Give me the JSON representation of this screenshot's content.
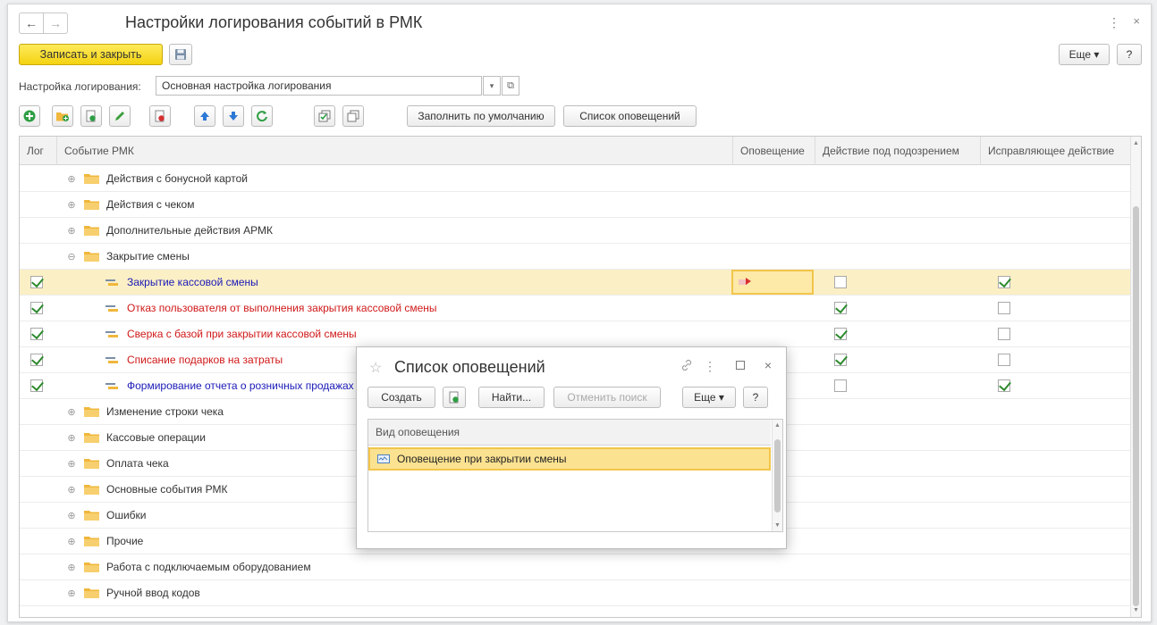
{
  "window": {
    "title": "Настройки логирования событий в РМК",
    "menu_icon": "⋮",
    "close_icon": "×",
    "back_icon": "←",
    "forward_icon": "→"
  },
  "command_bar": {
    "write_close_label": "Записать и закрыть",
    "more_label": "Еще ▾",
    "help_label": "?"
  },
  "setting": {
    "label": "Настройка логирования:",
    "value": "Основная настройка логирования",
    "dropdown_icon": "▾",
    "open_icon": "⧉"
  },
  "toolbar": {
    "fill_default_label": "Заполнить по умолчанию",
    "notification_list_label": "Список оповещений",
    "icons": [
      "add-icon",
      "add-folder-icon",
      "copy-icon",
      "edit-icon",
      "delete-icon",
      "move-up-icon",
      "move-down-icon",
      "refresh-icon",
      "select-all-icon",
      "deselect-all-icon"
    ]
  },
  "table": {
    "columns": {
      "log": "Лог",
      "event": "Событие РМК",
      "notification": "Оповещение",
      "suspicion_action": "Действие под подозрением",
      "corrective_action": "Исправляющее действие"
    },
    "groups_top": [
      {
        "name": "Действия с бонусной картой",
        "toggle": "⊕"
      },
      {
        "name": "Действия с чеком",
        "toggle": "⊕"
      },
      {
        "name": "Дополнительные действия АРМК",
        "toggle": "⊕"
      },
      {
        "name": "Закрытие смены",
        "toggle": "⊖"
      }
    ],
    "items": [
      {
        "name": "Закрытие кассовой смены",
        "color": "#1a1ab8",
        "log": true,
        "suspicion": false,
        "corrective": true
      },
      {
        "name": "Отказ пользователя от выполнения закрытия кассовой смены",
        "color": "#d01818",
        "log": true,
        "suspicion": true,
        "corrective": false
      },
      {
        "name": "Сверка с базой при закрытии кассовой смены",
        "color": "#d01818",
        "log": true,
        "suspicion": true,
        "corrective": false
      },
      {
        "name": "Списание подарков на затраты",
        "color": "#d01818",
        "log": true,
        "suspicion": true,
        "corrective": false
      },
      {
        "name": "Формирование отчета о розничных продажах",
        "color": "#1a1ab8",
        "log": true,
        "suspicion": false,
        "corrective": true
      }
    ],
    "groups_bottom": [
      {
        "name": "Изменение строки чека",
        "toggle": "⊕"
      },
      {
        "name": "Кассовые операции",
        "toggle": "⊕"
      },
      {
        "name": "Оплата чека",
        "toggle": "⊕"
      },
      {
        "name": "Основные события РМК",
        "toggle": "⊕"
      },
      {
        "name": "Ошибки",
        "toggle": "⊕"
      },
      {
        "name": "Прочие",
        "toggle": "⊕"
      },
      {
        "name": "Работа с подключаемым оборудованием",
        "toggle": "⊕"
      },
      {
        "name": "Ручной ввод кодов",
        "toggle": "⊕"
      }
    ]
  },
  "dialog": {
    "title": "Список оповещений",
    "star_icon": "☆",
    "link_icon": "🔗",
    "menu_icon": "⋮",
    "close_icon": "×",
    "create_label": "Создать",
    "find_label": "Найти...",
    "cancel_search_label": "Отменить поиск",
    "more_label": "Еще ▾",
    "help_label": "?",
    "list_header": "Вид оповещения",
    "list_items": [
      "Оповещение при закрытии смены"
    ]
  },
  "colors": {
    "primary_button": "#f4d210",
    "selected_row": "#fbefc5",
    "blue_link": "#1a1ab8",
    "red_text": "#d01818"
  }
}
